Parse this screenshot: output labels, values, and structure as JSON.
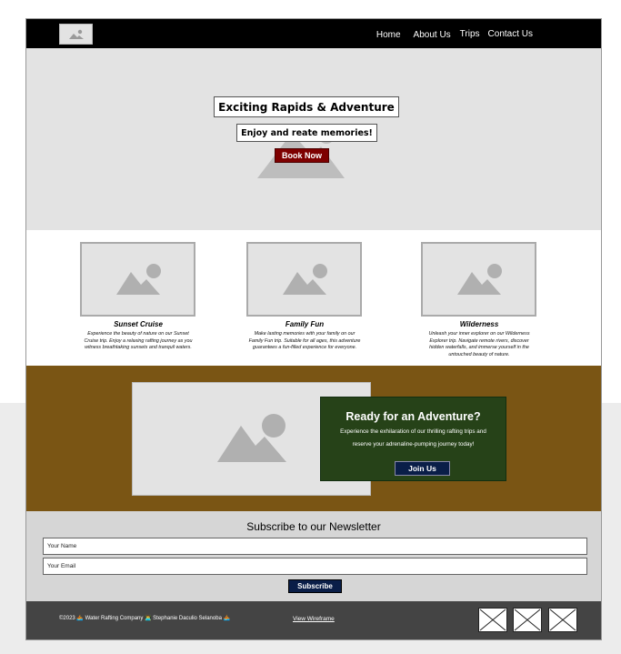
{
  "nav": {
    "logo_icon": "image-placeholder-icon",
    "links": [
      "Home",
      "About Us",
      "Trips",
      "Contact Us"
    ]
  },
  "hero": {
    "title": "Exciting Rapids & Adventure",
    "subtitle": "Enjoy and reate memories!",
    "button": "Book Now"
  },
  "trips": [
    {
      "title": "Sunset Cruise",
      "description": "Experience the beauty of nature on our Sunset Cruise trip. Enjoy a relaxing rafting journey as you witness breathtaking sunsets and tranquil waters."
    },
    {
      "title": "Family Fun",
      "description": "Make lasting memories with your family on our Family Fun trip. Suitable for all ages, this adventure guarantees a fun-filled experience for everyone."
    },
    {
      "title": "Wilderness",
      "description": "Unleash your inner explorer on our Wilderness Explorer trip. Navigate remote rivers, discover hidden waterfalls, and immerse yourself in the untouched beauty of nature."
    }
  ],
  "adventure": {
    "title": "Ready for an Adventure?",
    "text": "Experience the exhilaration of our thrilling rafting trips and reserve your adrenaline-pumping journey today!",
    "button": "Join Us"
  },
  "newsletter": {
    "title": "Subscribe to our Newsletter",
    "name_placeholder": "Your Name",
    "email_placeholder": "Your Email",
    "button": "Subscribe"
  },
  "footer": {
    "copyright": "©2023 🚣 Water Rafting Company 👨‍💻 Stephanie Daculio Selanoba 🚣",
    "link": "View Wireframe",
    "social_icons": [
      "social-placeholder-icon",
      "social-placeholder-icon",
      "social-placeholder-icon"
    ]
  },
  "colors": {
    "nav": "#000000",
    "hero_bg": "#e3e3e3",
    "book_button": "#7e0000",
    "adventure_bg": "#7a5514",
    "adventure_box": "#264218",
    "button_navy": "#0a1e48",
    "newsletter_bg": "#d6d6d6",
    "footer_bg": "#444444"
  }
}
